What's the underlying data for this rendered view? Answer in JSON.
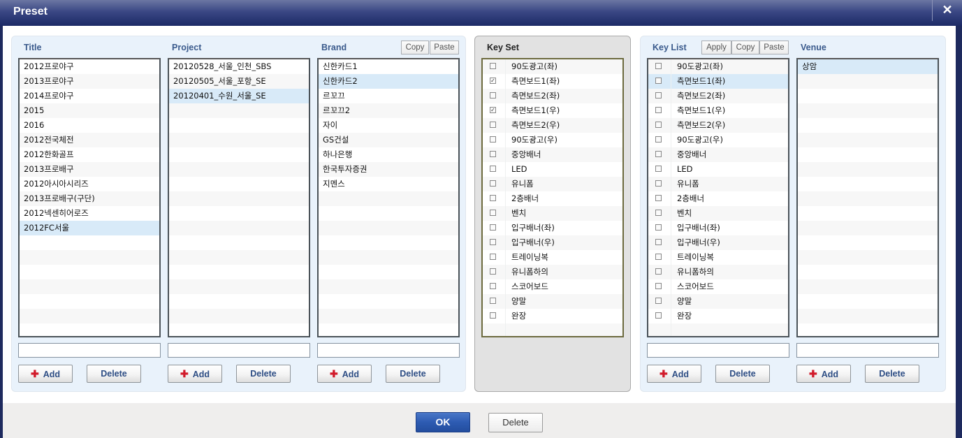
{
  "window": {
    "title": "Preset",
    "close_label": "✕"
  },
  "columns": {
    "title": {
      "label": "Title",
      "items": [
        "2012프로야구",
        "2013프로야구",
        "2014프로야구",
        "2015",
        "2016",
        "2012전국체전",
        "2012한화골프",
        "2013프로배구",
        "2012아시아시리즈",
        "2013프로배구(구단)",
        "2012넥센히어로즈",
        "2012FC서울"
      ],
      "selected_index": 11,
      "input_value": "",
      "add_label": "Add",
      "delete_label": "Delete"
    },
    "project": {
      "label": "Project",
      "items": [
        "20120528_서울_인천_SBS",
        "20120505_서울_포항_SE",
        "20120401_수원_서울_SE"
      ],
      "selected_index": 2,
      "input_value": "",
      "add_label": "Add",
      "delete_label": "Delete"
    },
    "brand": {
      "label": "Brand",
      "copy_label": "Copy",
      "paste_label": "Paste",
      "items": [
        "신한카드1",
        "신한카드2",
        "르꼬끄",
        "르꼬끄2",
        "자이",
        "GS건설",
        "하나은행",
        "한국투자증권",
        "지멘스"
      ],
      "selected_index": 1,
      "input_value": "",
      "add_label": "Add",
      "delete_label": "Delete"
    },
    "key_set": {
      "label": "Key Set",
      "items": [
        {
          "label": "90도광고(좌)",
          "checked": false
        },
        {
          "label": "측면보드1(좌)",
          "checked": true
        },
        {
          "label": "측면보드2(좌)",
          "checked": false
        },
        {
          "label": "측면보드1(우)",
          "checked": true
        },
        {
          "label": "측면보드2(우)",
          "checked": false
        },
        {
          "label": "90도광고(우)",
          "checked": false
        },
        {
          "label": "중앙배너",
          "checked": false
        },
        {
          "label": "LED",
          "checked": false
        },
        {
          "label": "유니폼",
          "checked": false
        },
        {
          "label": "2층배너",
          "checked": false
        },
        {
          "label": "벤치",
          "checked": false
        },
        {
          "label": "입구배너(좌)",
          "checked": false
        },
        {
          "label": "입구배너(우)",
          "checked": false
        },
        {
          "label": "트레이닝복",
          "checked": false
        },
        {
          "label": "유니폼하의",
          "checked": false
        },
        {
          "label": "스코어보드",
          "checked": false
        },
        {
          "label": "양말",
          "checked": false
        },
        {
          "label": "완장",
          "checked": false
        }
      ]
    },
    "key_list": {
      "label": "Key List",
      "apply_label": "Apply",
      "copy_label": "Copy",
      "paste_label": "Paste",
      "items": [
        {
          "label": "90도광고(좌)",
          "checked": false
        },
        {
          "label": "측면보드1(좌)",
          "checked": false
        },
        {
          "label": "측면보드2(좌)",
          "checked": false
        },
        {
          "label": "측면보드1(우)",
          "checked": false
        },
        {
          "label": "측면보드2(우)",
          "checked": false
        },
        {
          "label": "90도광고(우)",
          "checked": false
        },
        {
          "label": "중앙배너",
          "checked": false
        },
        {
          "label": "LED",
          "checked": false
        },
        {
          "label": "유니폼",
          "checked": false
        },
        {
          "label": "2층배너",
          "checked": false
        },
        {
          "label": "벤치",
          "checked": false
        },
        {
          "label": "입구배너(좌)",
          "checked": false
        },
        {
          "label": "입구배너(우)",
          "checked": false
        },
        {
          "label": "트레이닝복",
          "checked": false
        },
        {
          "label": "유니폼하의",
          "checked": false
        },
        {
          "label": "스코어보드",
          "checked": false
        },
        {
          "label": "양말",
          "checked": false
        },
        {
          "label": "완장",
          "checked": false
        }
      ],
      "selected_index": 1,
      "input_value": "",
      "add_label": "Add",
      "delete_label": "Delete"
    },
    "venue": {
      "label": "Venue",
      "items": [
        "상암"
      ],
      "selected_index": 0,
      "input_value": "",
      "add_label": "Add",
      "delete_label": "Delete"
    }
  },
  "footer": {
    "ok_label": "OK",
    "delete_label": "Delete"
  },
  "icons": {
    "add": "plus-icon",
    "checkbox_checked": "☑",
    "close": "close-icon"
  },
  "colors": {
    "title_bar": "#1c2a66",
    "ok_button": "#2d5bb2",
    "label_blue": "#3a5a8c",
    "add_plus": "#d11a2a",
    "selected_row": "#d8eaf8"
  }
}
